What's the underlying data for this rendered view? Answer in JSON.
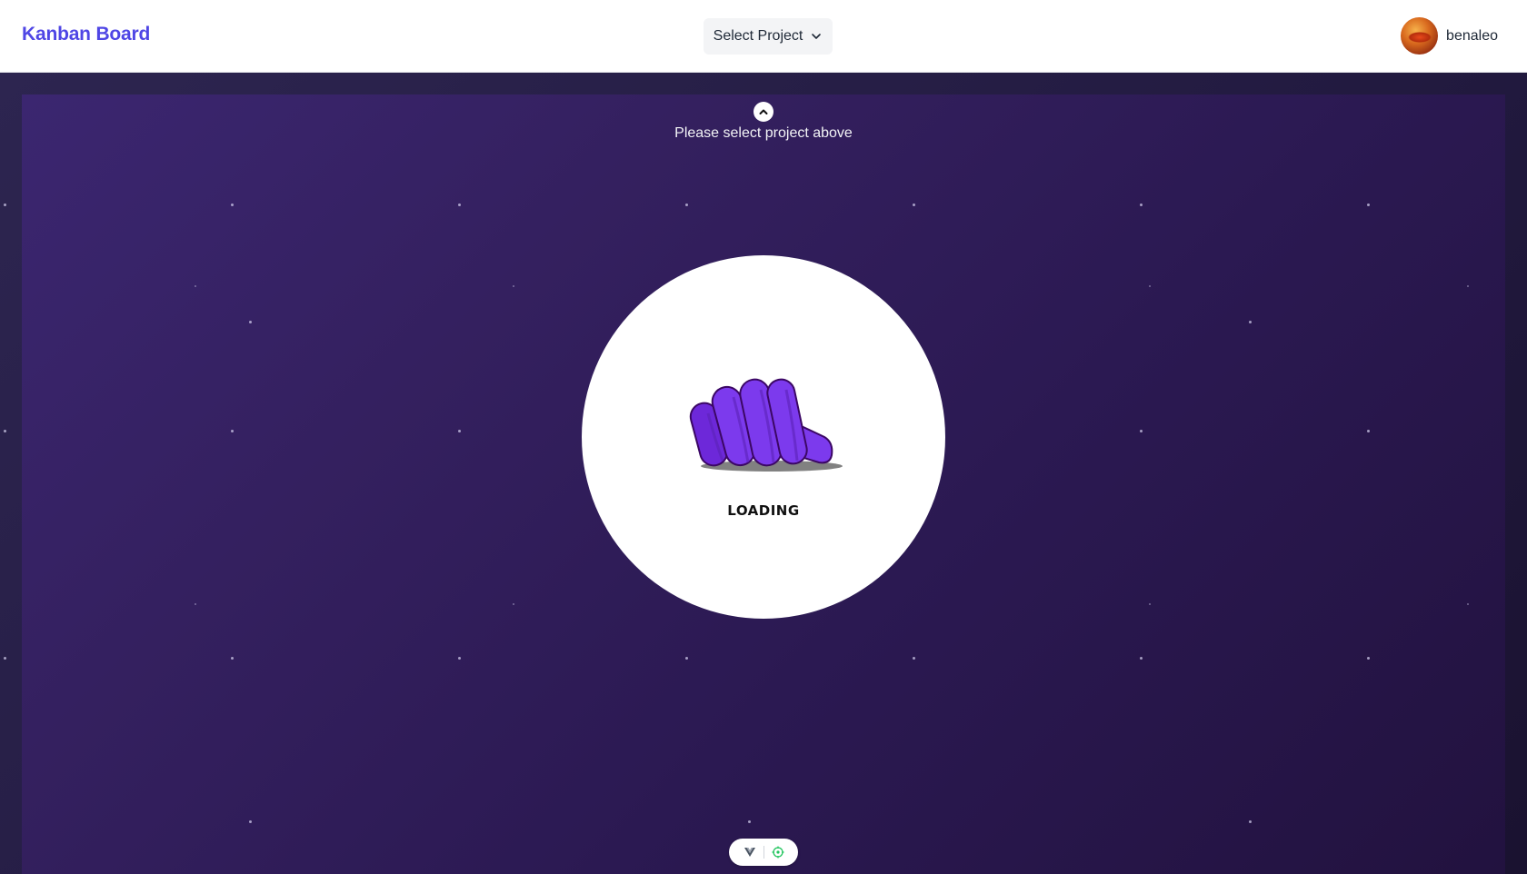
{
  "header": {
    "brand": "Kanban Board",
    "project_select": {
      "label": "Select Project",
      "icon": "chevron-down-icon"
    },
    "user": {
      "name": "benaleo",
      "avatar": "user-avatar"
    }
  },
  "main": {
    "hint_icon": "chevron-up-circle-icon",
    "hint_text": "Please select project above",
    "loader": {
      "text": "LOADING",
      "icon": "fist-hand-icon"
    }
  },
  "devtools": {
    "icons": [
      "vue-devtools-icon",
      "inspector-icon"
    ]
  },
  "colors": {
    "brand": "#4f46e5",
    "panel_gradient_start": "#3b2670",
    "panel_gradient_end": "#22123f",
    "hand_purple": "#7c3aed"
  }
}
